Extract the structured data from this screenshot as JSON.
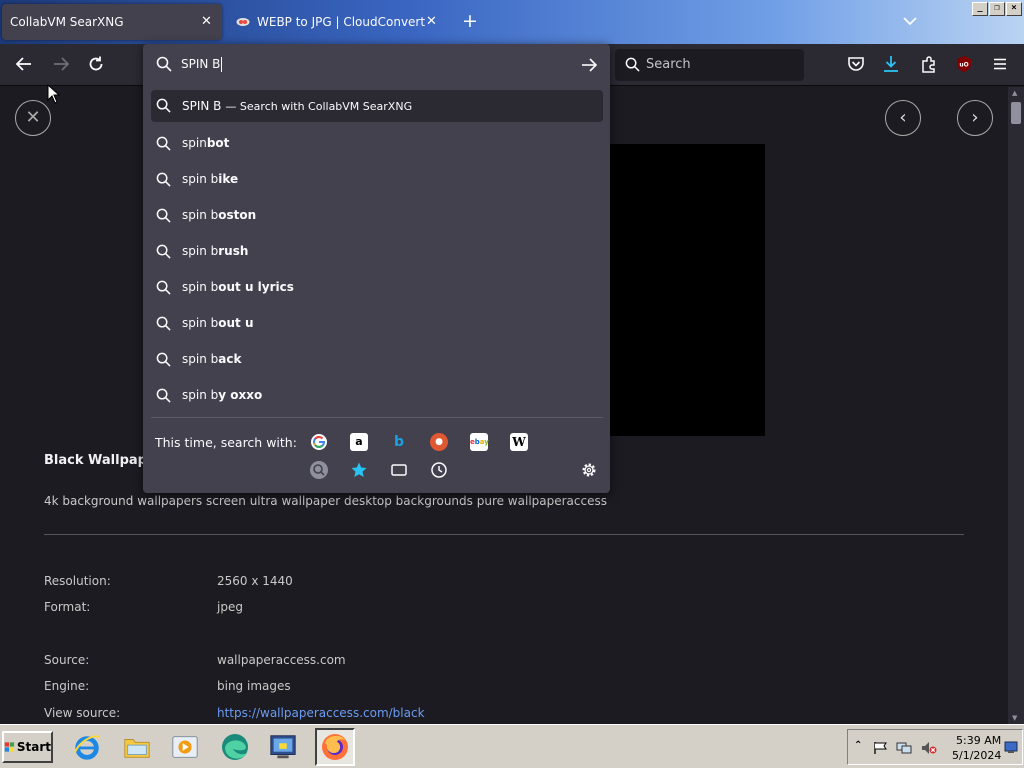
{
  "tabs": [
    {
      "title": "CollabVM SearXNG",
      "active": true
    },
    {
      "title": "WEBP to JPG | CloudConvert",
      "active": false
    }
  ],
  "window_buttons": [
    "_",
    "❐",
    "×"
  ],
  "toolbar": {
    "search_placeholder": "Search"
  },
  "urlbar": {
    "typed_text": "SPIN B",
    "first_result": {
      "text": "SPIN B",
      "action": "— Search with CollabVM SearXNG"
    },
    "suggestions": [
      {
        "prefix": "spin",
        "bold": "bot"
      },
      {
        "prefix": "spin b",
        "bold": "ike"
      },
      {
        "prefix": "spin b",
        "bold": "oston"
      },
      {
        "prefix": "spin b",
        "bold": "rush"
      },
      {
        "prefix": "spin b",
        "bold": "out u lyrics"
      },
      {
        "prefix": "spin b",
        "bold": "out u"
      },
      {
        "prefix": "spin b",
        "bold": "ack"
      },
      {
        "prefix": "spin b",
        "bold": "y oxxo"
      }
    ],
    "one_offs_label": "This time, search with:",
    "engines": [
      "google-icon",
      "amazon-icon",
      "bing-icon",
      "duckduckgo-icon",
      "ebay-icon",
      "wikipedia-icon",
      "searxng-icon"
    ],
    "engine_glyphs": {
      "amazon": "a",
      "bing": "b",
      "ebay": "ebay",
      "wiki": "W"
    }
  },
  "page": {
    "title": "Black Wallpaper",
    "description": "4k background wallpapers screen ultra wallpaper desktop backgrounds pure wallpaperaccess",
    "meta": [
      {
        "label": "Resolution:",
        "value": "2560 x 1440"
      },
      {
        "label": "Format:",
        "value": "jpeg"
      },
      {
        "label": "Source:",
        "value": "wallpaperaccess.com"
      },
      {
        "label": "Engine:",
        "value": "bing images"
      },
      {
        "label": "View source:",
        "value": "https://wallpaperaccess.com/black"
      }
    ]
  },
  "taskbar": {
    "start_label": "Start",
    "clock_time": "5:39 AM",
    "clock_date": "5/1/2024"
  },
  "colors": {
    "toolbar": "#2b2a33",
    "dropdown": "#42414d",
    "page_bg": "#1c1b22",
    "link": "#6b9cf3",
    "download_accent": "#2ac3f5",
    "ublock": "#800000"
  }
}
